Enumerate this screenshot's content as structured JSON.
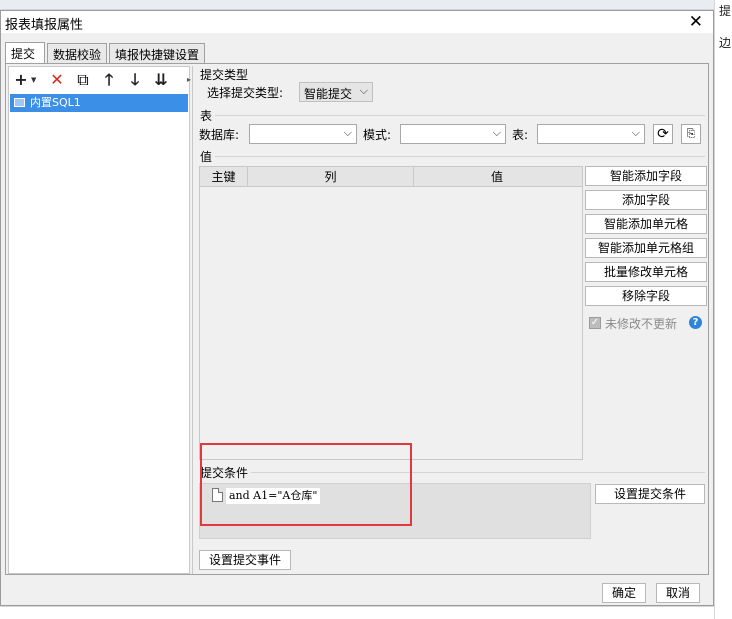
{
  "dialog": {
    "title": "报表填报属性"
  },
  "background": {
    "right_chars": [
      "提",
      "边"
    ]
  },
  "tabs": [
    "提交",
    "数据校验",
    "填报快捷键设置"
  ],
  "toolbar": {
    "add": "+",
    "delete": "✕",
    "copy": "⧉",
    "up": "🡑",
    "down": "🡓",
    "bottom": "⇊"
  },
  "tree": {
    "items": [
      "内置SQL1"
    ]
  },
  "submit_type": {
    "section": "提交类型",
    "label": "选择提交类型:",
    "value": "智能提交"
  },
  "table_section": {
    "section": "表",
    "db_label": "数据库:",
    "mode_label": "模式:",
    "table_label": "表:",
    "db_value": "",
    "mode_value": "",
    "table_value": ""
  },
  "value_section": {
    "section": "值",
    "columns": [
      "主键",
      "列",
      "值"
    ]
  },
  "side_buttons": [
    "智能添加字段",
    "添加字段",
    "智能添加单元格",
    "智能添加单元格组",
    "批量修改单元格",
    "移除字段"
  ],
  "checkbox": {
    "label": "未修改不更新",
    "checked": true
  },
  "condition": {
    "section": "提交条件",
    "items": [
      "and A1=\"A仓库\""
    ],
    "set_button": "设置提交条件"
  },
  "event_button": "设置提交事件",
  "footer": {
    "ok": "确定",
    "cancel": "取消"
  }
}
